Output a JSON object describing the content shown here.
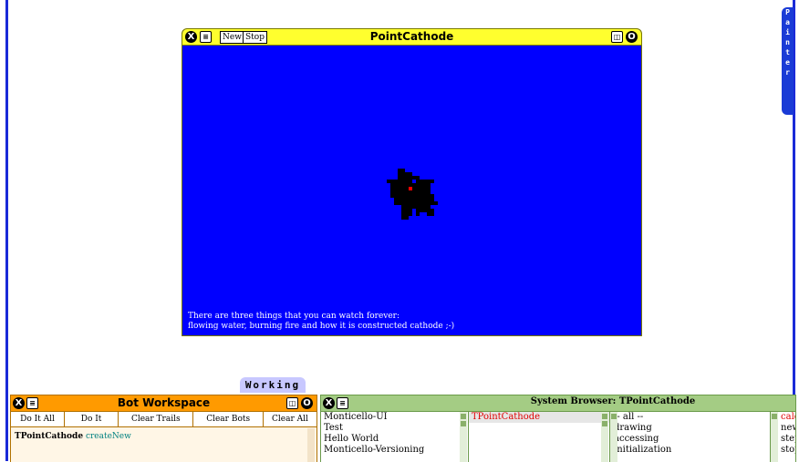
{
  "flap": {
    "letters": [
      "P",
      "a",
      "i",
      "n",
      "t",
      "e",
      "r"
    ]
  },
  "point_cathode": {
    "title": "PointCathode",
    "new_label": "New",
    "stop_label": "Stop",
    "close_glyph": "X",
    "menu_glyph": "≡",
    "collapse_glyph": "◫",
    "expand_glyph": "O",
    "caption_line1": "There are three things that you can watch forever:",
    "caption_line2": "flowing water, burning fire and how it is constructed cathode ;-)",
    "colors": {
      "background": "#0000ff",
      "title_bar": "#ffff2e",
      "cluster": "#000000",
      "seed": "#ff0000"
    }
  },
  "working_tab": {
    "label": "Working"
  },
  "bot_workspace": {
    "title": "Bot Workspace",
    "close_glyph": "X",
    "menu_glyph": "≡",
    "collapse_glyph": "◫",
    "expand_glyph": "O",
    "buttons": [
      "Do It All",
      "Do It",
      "Clear Trails",
      "Clear Bots",
      "Clear All"
    ],
    "code_class": "TPointCathode",
    "code_message": "createNew",
    "colors": {
      "title_bar": "#ff9a00",
      "body": "#fff6e6"
    }
  },
  "system_browser": {
    "title": "System Browser: TPointCathode",
    "close_glyph": "X",
    "menu_glyph": "≡",
    "packages": [
      "Monticello-UI",
      "Test",
      "Hello World",
      "Monticello-Versioning"
    ],
    "classes": [
      "TPointCathode"
    ],
    "categories": [
      "-- all --",
      "drawing",
      "accessing",
      "initialization"
    ],
    "methods": [
      "calc",
      "new",
      "step",
      "stop"
    ],
    "colors": {
      "title_bar": "#a4cc84"
    }
  }
}
